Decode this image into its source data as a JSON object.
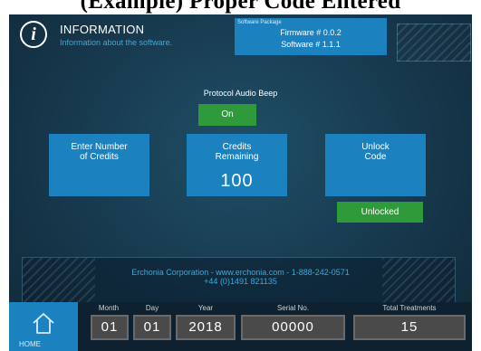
{
  "caption": "(Example) Proper Code Entered",
  "header": {
    "title": "INFORMATION",
    "subtitle": "Information about the software.",
    "info_icon": "info-icon"
  },
  "package": {
    "label": "Software Package",
    "firmware": "Firmware # 0.0.2",
    "software": "Software # 1.1.1"
  },
  "protocol_audio_beep": {
    "label": "Protocol Audio Beep",
    "state": "On"
  },
  "tiles": {
    "enter_credits": "Enter Number\nof Credits",
    "credits_remaining_label": "Credits\nRemaining",
    "credits_remaining_value": "100",
    "unlock_code": "Unlock\nCode"
  },
  "unlock_status": "Unlocked",
  "company": {
    "line1": "Erchonia Corporation  -  www.erchonia.com  -  1-888-242-0571",
    "line2": "+44 (0)1491 821135"
  },
  "home": {
    "label": "HOME",
    "icon": "home-icon"
  },
  "fields": {
    "month": {
      "label": "Month",
      "value": "01"
    },
    "day": {
      "label": "Day",
      "value": "01"
    },
    "year": {
      "label": "Year",
      "value": "2018"
    },
    "serial": {
      "label": "Serial No.",
      "value": "00000"
    },
    "total_treatments": {
      "label": "Total Treatments",
      "value": "15"
    }
  },
  "colors": {
    "accent_blue": "#1c82bf",
    "status_green": "#2e9a3a",
    "background": "#17384d"
  }
}
